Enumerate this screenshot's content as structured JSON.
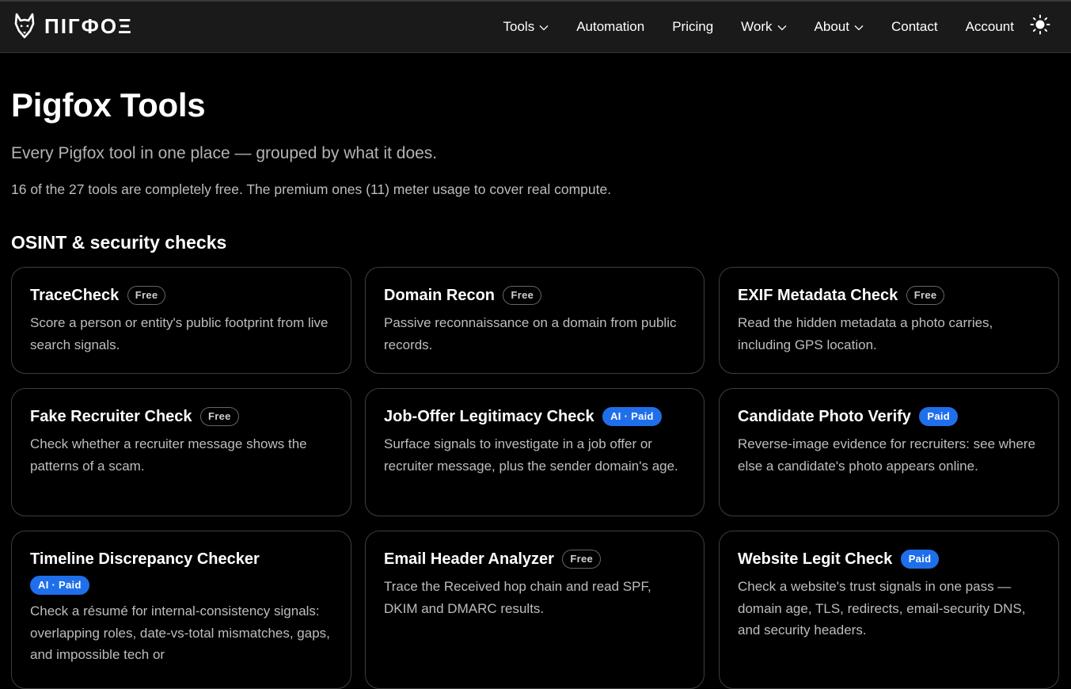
{
  "brand": {
    "wordmark": "ПІГФОΞ"
  },
  "nav": {
    "items": [
      {
        "label": "Tools",
        "dropdown": true
      },
      {
        "label": "Automation",
        "dropdown": false
      },
      {
        "label": "Pricing",
        "dropdown": false
      },
      {
        "label": "Work",
        "dropdown": true
      },
      {
        "label": "About",
        "dropdown": true
      },
      {
        "label": "Contact",
        "dropdown": false
      },
      {
        "label": "Account",
        "dropdown": false
      }
    ],
    "theme_icon": "sun-icon"
  },
  "page": {
    "title": "Pigfox Tools",
    "subtitle": "Every Pigfox tool in one place — grouped by what it does.",
    "note": "16 of the 27 tools are completely free. The premium ones (11) meter usage to cover real compute."
  },
  "section": {
    "heading": "OSINT & security checks",
    "cards": [
      {
        "title": "TraceCheck",
        "badge": "Free",
        "badge_type": "free",
        "desc": "Score a person or entity's public footprint from live search signals."
      },
      {
        "title": "Domain Recon",
        "badge": "Free",
        "badge_type": "free",
        "desc": "Passive reconnaissance on a domain from public records."
      },
      {
        "title": "EXIF Metadata Check",
        "badge": "Free",
        "badge_type": "free",
        "desc": "Read the hidden metadata a photo carries, including GPS location."
      },
      {
        "title": "Fake Recruiter Check",
        "badge": "Free",
        "badge_type": "free",
        "desc": "Check whether a recruiter message shows the patterns of a scam."
      },
      {
        "title": "Job-Offer Legitimacy Check",
        "badge": "AI · Paid",
        "badge_type": "paid",
        "desc": "Surface signals to investigate in a job offer or recruiter message, plus the sender domain's age."
      },
      {
        "title": "Candidate Photo Verify",
        "badge": "Paid",
        "badge_type": "paid",
        "desc": "Reverse-image evidence for recruiters: see where else a candidate's photo appears online."
      },
      {
        "title": "Timeline Discrepancy Checker",
        "badge": "AI · Paid",
        "badge_type": "paid",
        "desc": "Check a résumé for internal-consistency signals: overlapping roles, date-vs-total mismatches, gaps, and impossible tech or"
      },
      {
        "title": "Email Header Analyzer",
        "badge": "Free",
        "badge_type": "free",
        "desc": "Trace the Received hop chain and read SPF, DKIM and DMARC results."
      },
      {
        "title": "Website Legit Check",
        "badge": "Paid",
        "badge_type": "paid",
        "desc": "Check a website's trust signals in one pass — domain age, TLS, redirects, email-security DNS, and security headers."
      }
    ]
  },
  "colors": {
    "background": "#000000",
    "topbar": "#1a1a1a",
    "paid_badge": "#1f6feb",
    "muted_text": "#bdbdbd"
  }
}
